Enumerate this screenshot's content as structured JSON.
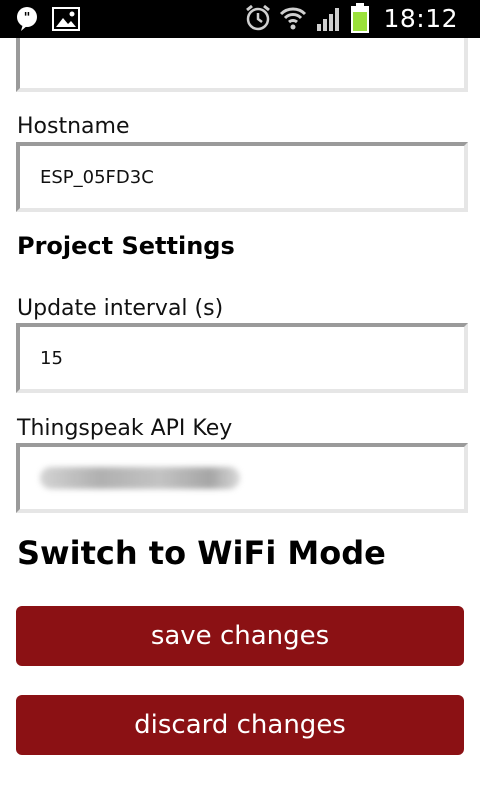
{
  "status_bar": {
    "time": "18:12",
    "icons": [
      "notification-icon",
      "image-icon",
      "alarm-icon",
      "wifi-icon",
      "signal-icon",
      "battery-icon"
    ]
  },
  "form": {
    "top_field_value": "",
    "hostname_label": "Hostname",
    "hostname_value": "ESP_05FD3C",
    "project_heading": "Project Settings",
    "interval_label": "Update interval (s)",
    "interval_value": "15",
    "api_key_label": "Thingspeak API Key",
    "switch_heading": "Switch to WiFi Mode"
  },
  "buttons": {
    "save_label": "save changes",
    "discard_label": "discard changes"
  },
  "colors": {
    "button_bg": "#8b1114",
    "battery": "#9be13a"
  }
}
